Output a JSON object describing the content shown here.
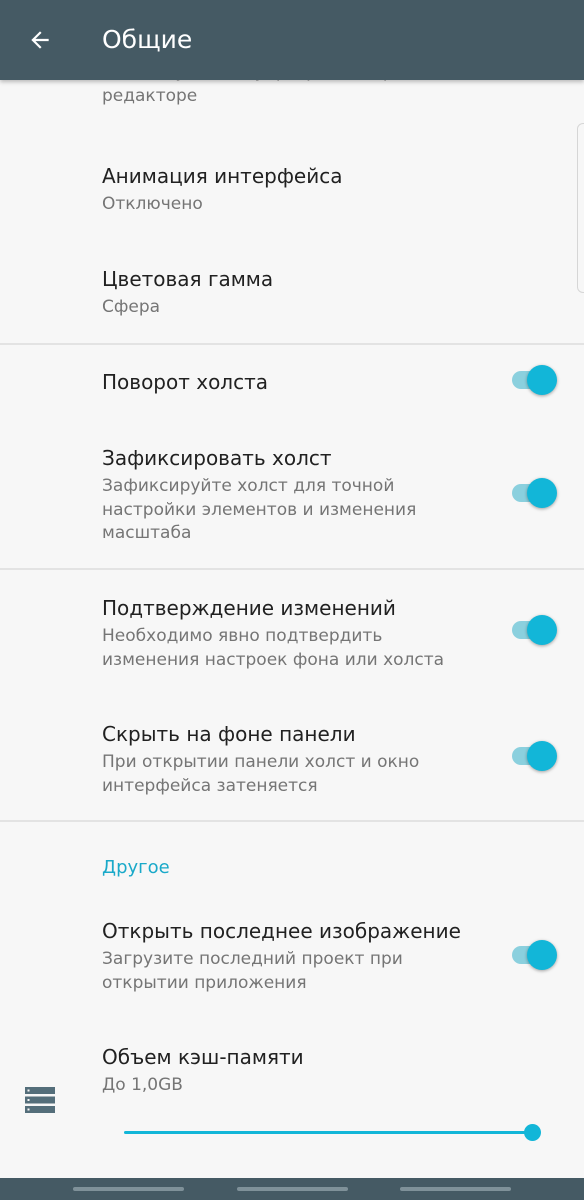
{
  "appbar": {
    "title": "Общие",
    "back_icon": "arrow-left-icon"
  },
  "settings": {
    "translucent": {
      "summary": "Используйте полупрозрачные фоны в редакторе",
      "enabled": true
    },
    "animation": {
      "title": "Анимация интерфейса",
      "summary": "Отключено"
    },
    "color_scheme": {
      "title": "Цветовая гамма",
      "summary": "Сфера"
    },
    "rotate_canvas": {
      "title": "Поворот холста",
      "enabled": true
    },
    "lock_canvas": {
      "title": "Зафиксировать холст",
      "summary": "Зафиксируйте холст для точной настройки элементов и изменения масштаба",
      "enabled": true
    },
    "confirm_changes": {
      "title": "Подтверждение изменений",
      "summary": "Необходимо явно подтвердить изменения настроек фона или холста",
      "enabled": true
    },
    "hide_under_panels": {
      "title": "Скрыть на фоне панели",
      "summary": "При открытии панели холст и окно интерфейса затеняется",
      "enabled": true
    }
  },
  "other": {
    "category_label": "Другое",
    "open_last_image": {
      "title": "Открыть последнее изображение",
      "summary": "Загрузите последний проект при открытии приложения",
      "enabled": true
    },
    "cache_size": {
      "title": "Объем кэш-памяти",
      "summary": "До 1,0GB",
      "slider_fraction": 1.0,
      "icon": "storage-icon"
    }
  },
  "colors": {
    "appbar": "#455a64",
    "accent": "#12b6d8",
    "category": "#1aa9c9",
    "background": "#f7f7f7"
  }
}
